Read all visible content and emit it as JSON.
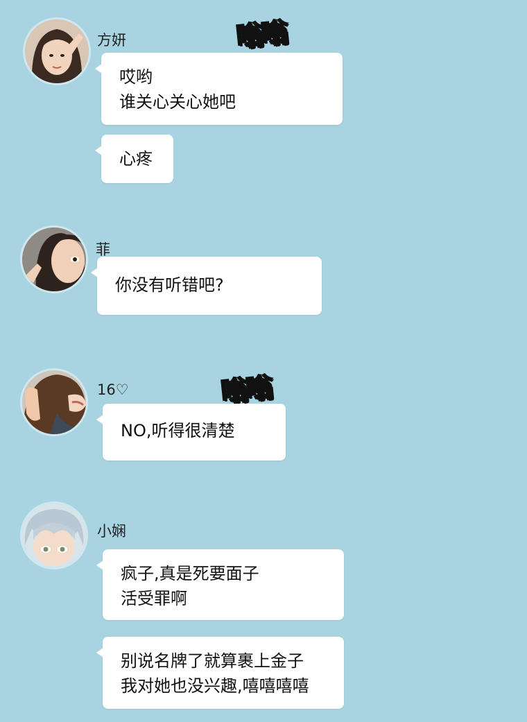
{
  "messages": [
    {
      "sender": "方妍",
      "bubbles": [
        [
          "哎哟",
          "谁关心关心她吧"
        ],
        [
          "心疼"
        ]
      ]
    },
    {
      "sender": "菲",
      "bubbles": [
        [
          "你没有听错吧?"
        ]
      ]
    },
    {
      "sender": "16♡",
      "bubbles": [
        [
          "NO,听得很清楚"
        ]
      ]
    },
    {
      "sender": "小娴",
      "bubbles": [
        [
          "疯子,真是死要面子",
          "活受罪啊"
        ],
        [
          "别说名牌了就算裹上金子",
          "我对她也没兴趣,嘻嘻嘻嘻"
        ]
      ]
    }
  ],
  "sfx": [
    "嗡嗡",
    "嗡嗡"
  ]
}
